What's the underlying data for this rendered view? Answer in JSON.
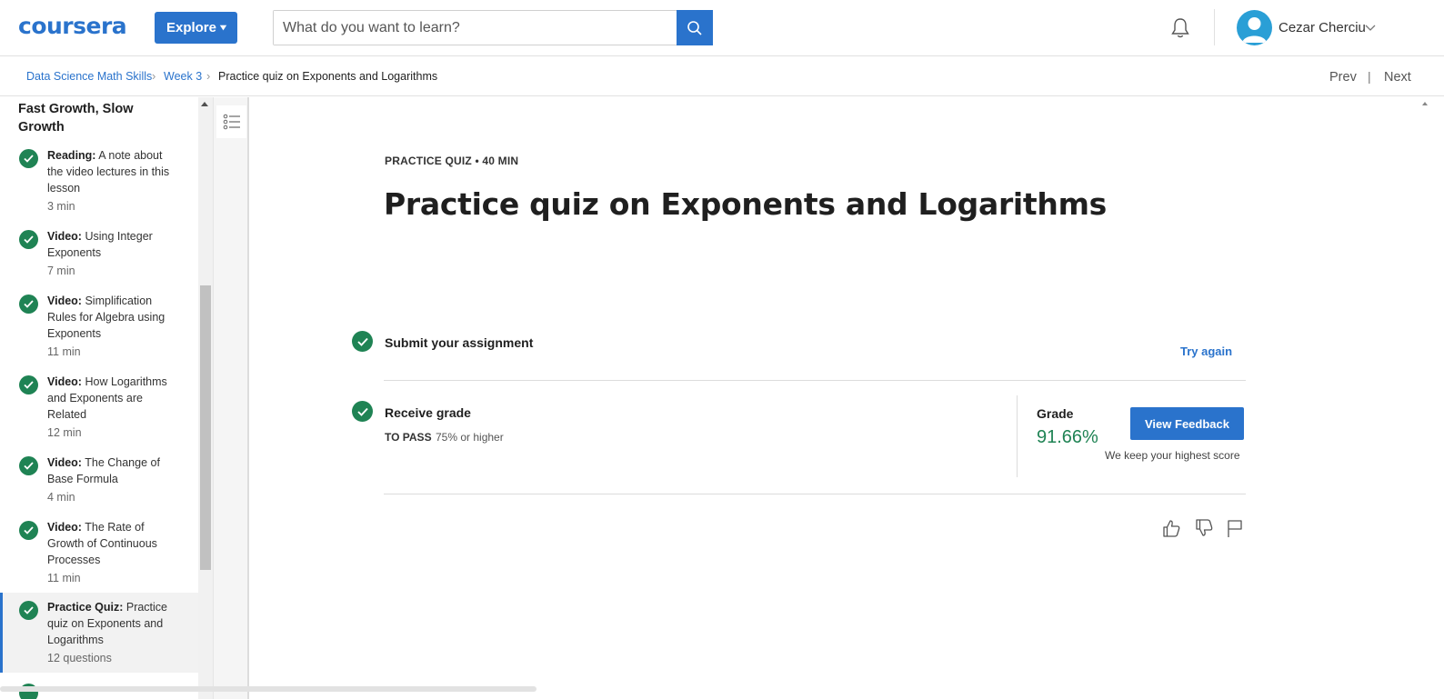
{
  "header": {
    "logo": "coursera",
    "explore_label": "Explore",
    "search_placeholder": "What do you want to learn?",
    "user_name": "Cezar Cherciu",
    "colors": {
      "brand": "#2a73cc",
      "success": "#1f8354"
    }
  },
  "breadcrumb": {
    "items": [
      "Data Science Math Skills",
      "Week 3",
      "Practice quiz on Exponents and Logarithms"
    ],
    "prev": "Prev",
    "next": "Next"
  },
  "sidebar": {
    "section_title": "Fast Growth, Slow Growth",
    "items": [
      {
        "type": "Reading:",
        "title": "A note about the video lectures in this lesson",
        "duration": "3 min"
      },
      {
        "type": "Video:",
        "title": "Using Integer Exponents",
        "duration": "7 min"
      },
      {
        "type": "Video:",
        "title": "Simplification Rules for Algebra using Exponents",
        "duration": "11 min"
      },
      {
        "type": "Video:",
        "title": "How Logarithms and Exponents are Related",
        "duration": "12 min"
      },
      {
        "type": "Video:",
        "title": "The Change of Base Formula",
        "duration": "4 min"
      },
      {
        "type": "Video:",
        "title": "The Rate of Growth of Continuous Processes",
        "duration": "11 min"
      },
      {
        "type": "Practice Quiz:",
        "title": "Practice quiz on Exponents and Logarithms",
        "duration": "12 questions"
      }
    ]
  },
  "main": {
    "meta": "PRACTICE QUIZ • 40 MIN",
    "title": "Practice quiz on Exponents and Logarithms",
    "submit_title": "Submit your assignment",
    "try_again": "Try again",
    "receive_title": "Receive grade",
    "to_pass_label": "TO PASS",
    "to_pass_value": "75% or higher",
    "grade_label": "Grade",
    "grade_value": "91.66%",
    "view_feedback": "View Feedback",
    "highest_note": "We keep your highest score"
  }
}
